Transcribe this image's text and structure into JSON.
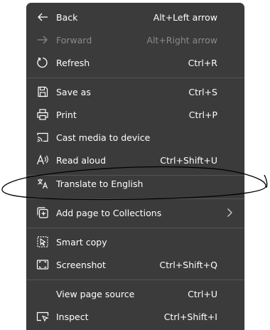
{
  "menu": {
    "items": [
      {
        "label": "Back",
        "shortcut": "Alt+Left arrow",
        "icon": "back-arrow-icon",
        "disabled": false
      },
      {
        "label": "Forward",
        "shortcut": "Alt+Right arrow",
        "icon": "forward-arrow-icon",
        "disabled": true
      },
      {
        "label": "Refresh",
        "shortcut": "Ctrl+R",
        "icon": "refresh-icon",
        "disabled": false
      },
      {
        "label": "Save as",
        "shortcut": "Ctrl+S",
        "icon": "save-as-icon",
        "disabled": false
      },
      {
        "label": "Print",
        "shortcut": "Ctrl+P",
        "icon": "printer-icon",
        "disabled": false
      },
      {
        "label": "Cast media to device",
        "shortcut": "",
        "icon": "cast-icon",
        "disabled": false
      },
      {
        "label": "Read aloud",
        "shortcut": "Ctrl+Shift+U",
        "icon": "read-aloud-icon",
        "disabled": false
      },
      {
        "label": "Translate to English",
        "shortcut": "",
        "icon": "translate-icon",
        "disabled": false
      },
      {
        "label": "Add page to Collections",
        "shortcut": "",
        "icon": "collections-icon",
        "disabled": false
      },
      {
        "label": "Smart copy",
        "shortcut": "",
        "icon": "smart-copy-icon",
        "disabled": false
      },
      {
        "label": "Screenshot",
        "shortcut": "Ctrl+Shift+Q",
        "icon": "screenshot-icon",
        "disabled": false
      },
      {
        "label": "View page source",
        "shortcut": "Ctrl+U",
        "icon": "",
        "disabled": false
      },
      {
        "label": "Inspect",
        "shortcut": "Ctrl+Shift+I",
        "icon": "inspect-icon",
        "disabled": false
      }
    ]
  },
  "colors": {
    "menu_background": "#3b3b3b",
    "text": "#ffffff",
    "disabled_text": "#8a8a8a",
    "separator": "#555555",
    "annotation_ink": "#000000"
  }
}
